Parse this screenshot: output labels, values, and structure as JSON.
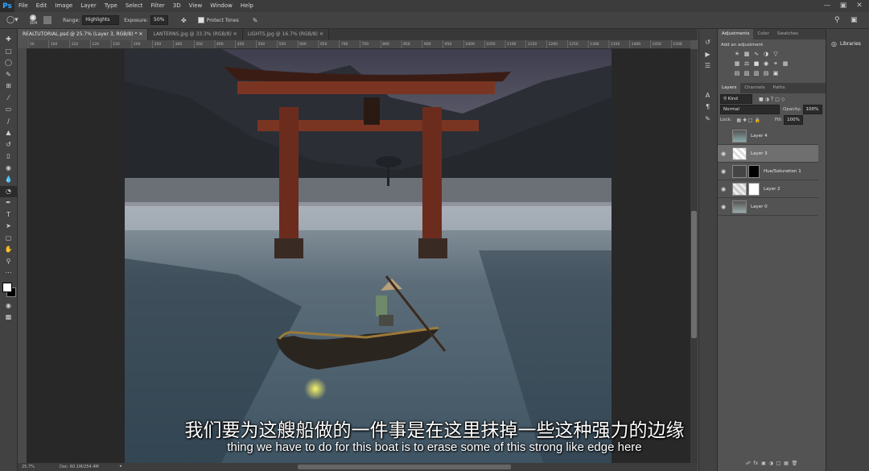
{
  "app": {
    "logo": "Ps"
  },
  "menu": [
    "File",
    "Edit",
    "Image",
    "Layer",
    "Type",
    "Select",
    "Filter",
    "3D",
    "View",
    "Window",
    "Help"
  ],
  "options": {
    "brush_size": "304",
    "range_label": "Range:",
    "range_value": "Highlights",
    "exposure_label": "Exposure:",
    "exposure_value": "50%",
    "protect_tones_label": "Protect Tones"
  },
  "tabs": [
    {
      "label": "REALTUTORIAL.psd @ 25.7% (Layer 3, RGB/8) *",
      "active": true
    },
    {
      "label": "LANTERNS.jpg @ 33.3% (RGB/8)",
      "active": false
    },
    {
      "label": "LIGHTS.jpg @ 16.7% (RGB/8)",
      "active": false
    }
  ],
  "ruler_labels": [
    "50",
    "100",
    "110",
    "120",
    "150",
    "200",
    "250",
    "300",
    "350",
    "400",
    "450",
    "500",
    "550",
    "600",
    "650",
    "700",
    "750",
    "800",
    "850",
    "900",
    "950",
    "1000",
    "1050",
    "1100",
    "1150",
    "1200",
    "1250",
    "1300",
    "1350",
    "1400",
    "1450",
    "1500"
  ],
  "status": {
    "zoom": "25.7%",
    "doc": "Doc: 60.1M/254.4M"
  },
  "adjustments_panel": {
    "tabs": [
      "Adjustments",
      "Color",
      "Swatches"
    ],
    "heading": "Add an adjustment"
  },
  "layers_panel": {
    "tabs": [
      "Layers",
      "Channels",
      "Paths"
    ],
    "kind": "Kind",
    "blend_mode": "Normal",
    "opacity_label": "Opacity:",
    "opacity_value": "100%",
    "lock_label": "Lock:",
    "fill_label": "Fill:",
    "fill_value": "100%",
    "layers": [
      {
        "name": "Layer 4",
        "visible": false,
        "selected": false
      },
      {
        "name": "Layer 3",
        "visible": true,
        "selected": true
      },
      {
        "name": "Hue/Saturation 1",
        "visible": true,
        "selected": false
      },
      {
        "name": "Layer 2",
        "visible": true,
        "selected": false
      },
      {
        "name": "Layer 0",
        "visible": true,
        "selected": false
      }
    ]
  },
  "libraries": {
    "label": "Libraries"
  },
  "subtitles": {
    "cn": "我们要为这艘船做的一件事是在这里抹掉一些这种强力的边缘",
    "en": "thing we have to do for this boat is to erase some of this strong like edge here"
  }
}
